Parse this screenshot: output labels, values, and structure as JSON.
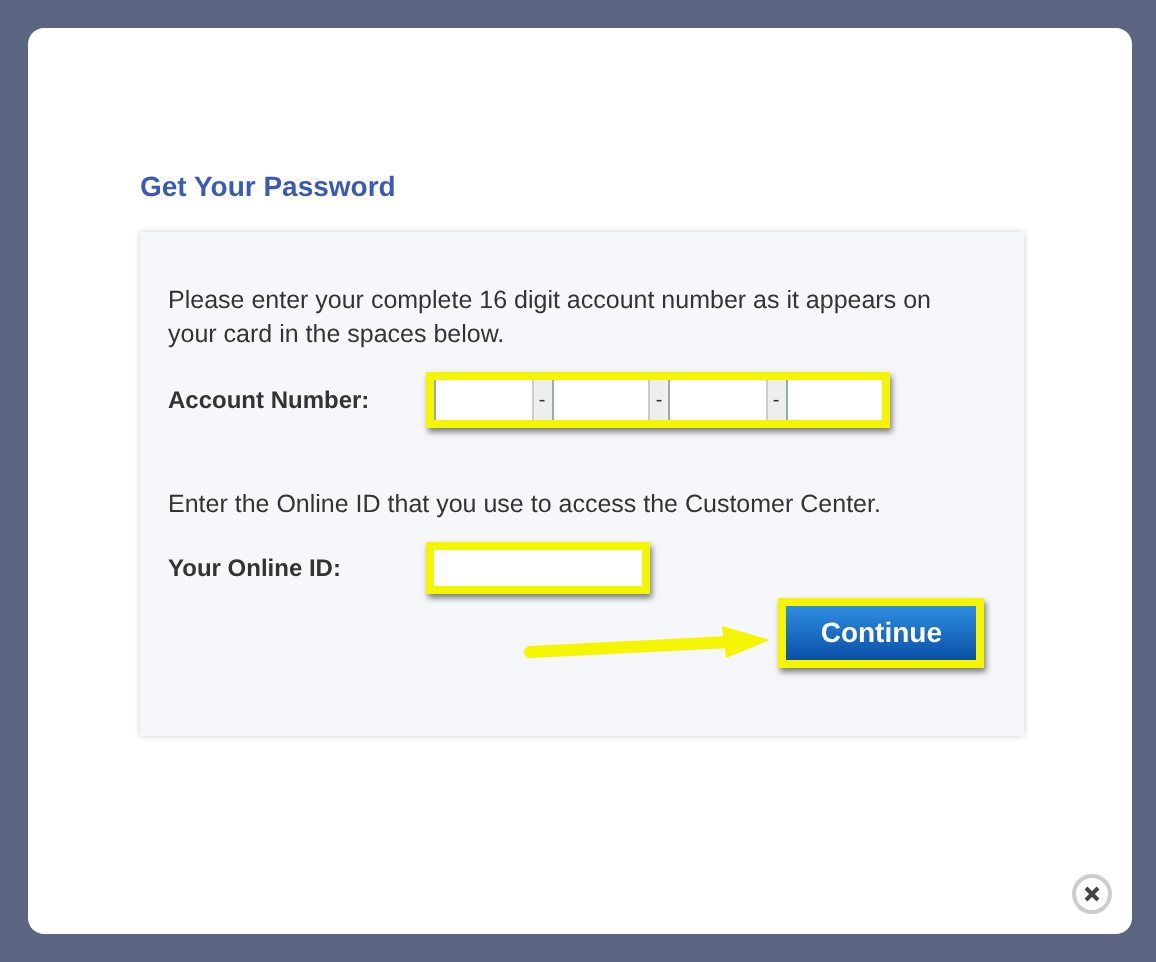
{
  "dialog": {
    "title": "Get Your Password",
    "account_instructions": "Please enter your complete 16 digit account number as it appears on your card in the spaces below.",
    "account_number": {
      "label": "Account Number:",
      "separators": [
        "-",
        "-",
        "-"
      ]
    },
    "online_id_instructions": "Enter the Online ID that you use to access the Customer Center.",
    "online_id": {
      "label": "Your Online ID:"
    },
    "continue_button": "Continue"
  }
}
